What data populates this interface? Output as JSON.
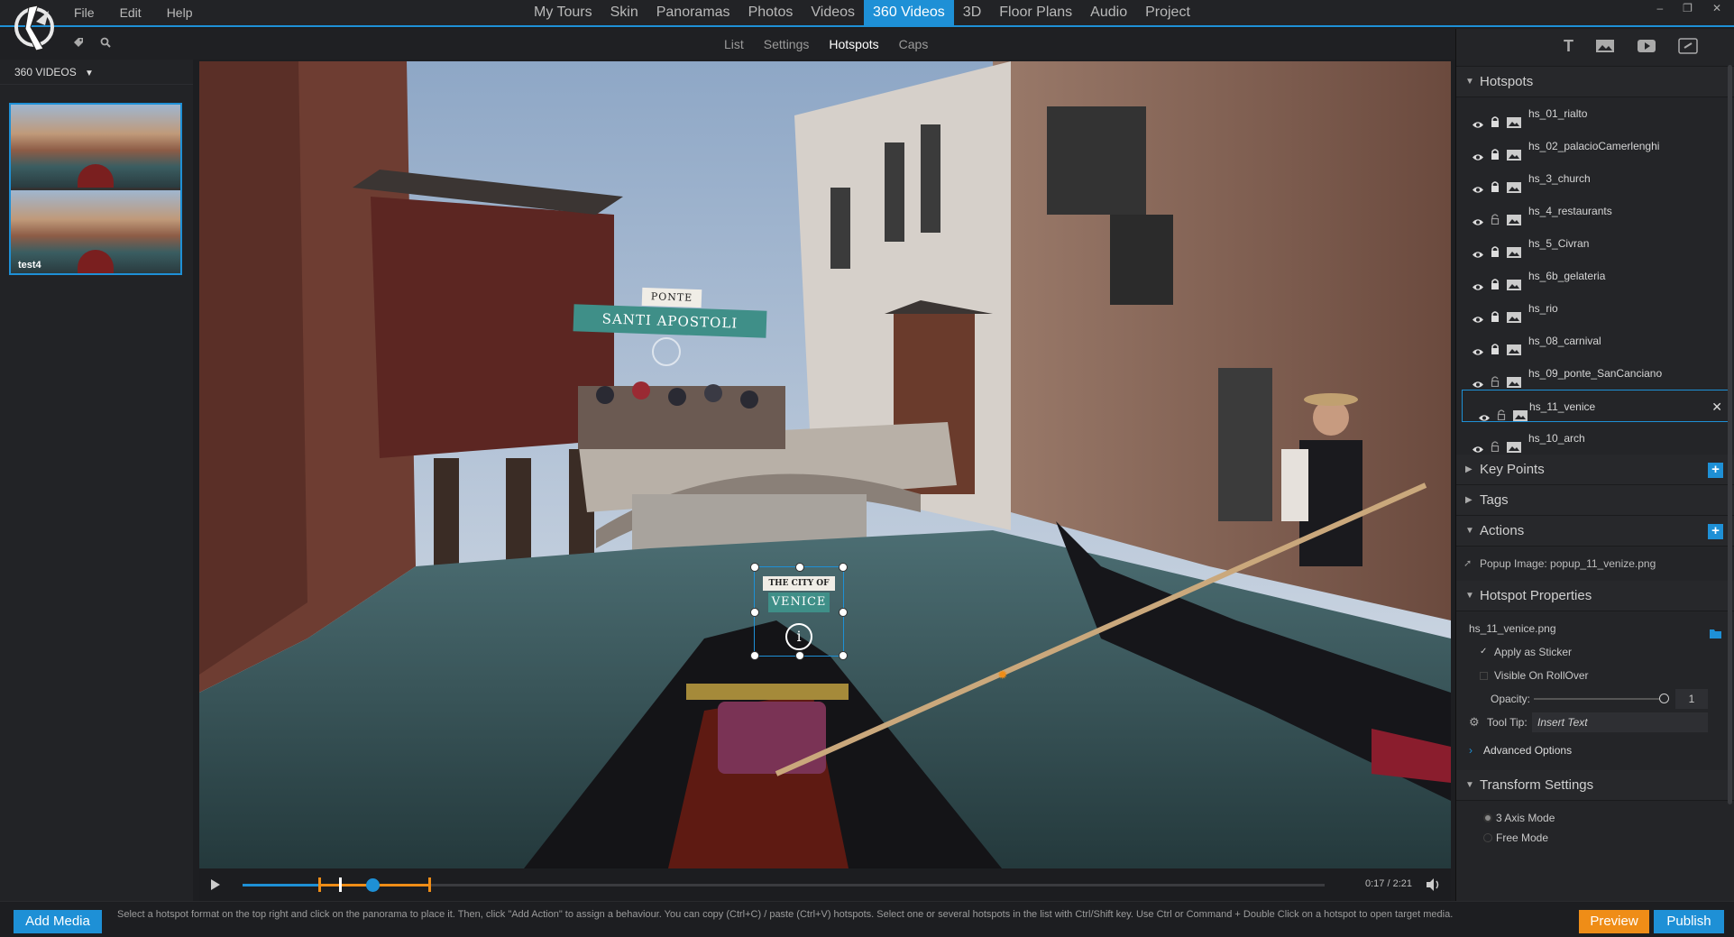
{
  "menu": {
    "file": "File",
    "edit": "Edit",
    "help": "Help"
  },
  "tabs": [
    {
      "label": "My Tours"
    },
    {
      "label": "Skin"
    },
    {
      "label": "Panoramas"
    },
    {
      "label": "Photos"
    },
    {
      "label": "Videos"
    },
    {
      "label": "360 Videos",
      "active": true
    },
    {
      "label": "3D"
    },
    {
      "label": "Floor Plans"
    },
    {
      "label": "Audio"
    },
    {
      "label": "Project"
    }
  ],
  "window_controls": {
    "minimize": "–",
    "restore": "❐",
    "close": "✕"
  },
  "subtabs": {
    "list": "List",
    "settings": "Settings",
    "hotspots": "Hotspots",
    "caps": "Caps"
  },
  "left_panel": {
    "header": "360 VIDEOS",
    "thumb_label": "test4"
  },
  "viewport": {
    "bridge_sign_small": "PONTE",
    "bridge_sign_large": "SANTI APOSTOLI",
    "hotspot_small": "THE CITY OF",
    "hotspot_large": "VENICE",
    "hotspot_icon": "i"
  },
  "timeline": {
    "time": "0:17 / 2:21",
    "progress": 0.12
  },
  "right_panel": {
    "hotspots_title": "Hotspots",
    "hotspots": [
      {
        "name": "hs_01_rialto",
        "locked": true
      },
      {
        "name": "hs_02_palacioCamerlenghi",
        "locked": true
      },
      {
        "name": "hs_3_church",
        "locked": true
      },
      {
        "name": "hs_4_restaurants",
        "locked": false
      },
      {
        "name": "hs_5_Civran",
        "locked": true
      },
      {
        "name": "hs_6b_gelateria",
        "locked": true
      },
      {
        "name": "hs_rio",
        "locked": true
      },
      {
        "name": "hs_08_carnival",
        "locked": true
      },
      {
        "name": "hs_09_ponte_SanCanciano",
        "locked": false
      },
      {
        "name": "hs_11_venice",
        "locked": false,
        "selected": true
      },
      {
        "name": "hs_10_arch",
        "locked": false
      }
    ],
    "key_points": "Key Points",
    "tags": "Tags",
    "actions": "Actions",
    "action_item": "Popup Image: popup_11_venize.png",
    "hotspot_properties": "Hotspot Properties",
    "file_name": "hs_11_venice.png",
    "apply_sticker": "Apply as Sticker",
    "visible_rollover": "Visible On RollOver",
    "opacity_label": "Opacity:",
    "opacity_value": "1",
    "tooltip_label": "Tool Tip:",
    "tooltip_placeholder": "Insert Text",
    "advanced_options": "Advanced Options",
    "transform_settings": "Transform Settings",
    "axis_mode": "3 Axis Mode",
    "free_mode": "Free Mode"
  },
  "status": {
    "add_media": "Add Media",
    "help_text": "Select a hotspot format on the top right and click on the panorama to place it. Then, click \"Add Action\" to assign a behaviour. You can copy (Ctrl+C) / paste (Ctrl+V) hotspots. Select one or several hotspots in the list with Ctrl/Shift key. Use Ctrl or Command + Double Click on a hotspot to open target media.",
    "preview": "Preview",
    "publish": "Publish"
  },
  "colors": {
    "accent": "#1e90d6",
    "preview": "#ef8d17",
    "sign_teal": "#3f8f88"
  }
}
